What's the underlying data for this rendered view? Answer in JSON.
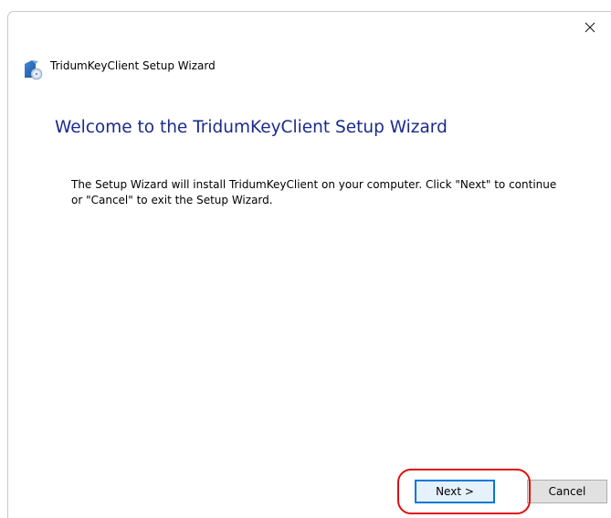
{
  "window": {
    "title": "TridumKeyClient Setup Wizard",
    "close_glyph": "✕"
  },
  "main": {
    "heading": "Welcome to the TridumKeyClient Setup Wizard",
    "description": "The Setup Wizard will install TridumKeyClient on your computer.  Click \"Next\" to continue or \"Cancel\" to exit the Setup Wizard."
  },
  "buttons": {
    "next_label": "Next >",
    "cancel_label": "Cancel"
  },
  "colors": {
    "heading": "#1a2a8c",
    "highlight": "#e01010",
    "focus": "#0078d7"
  }
}
